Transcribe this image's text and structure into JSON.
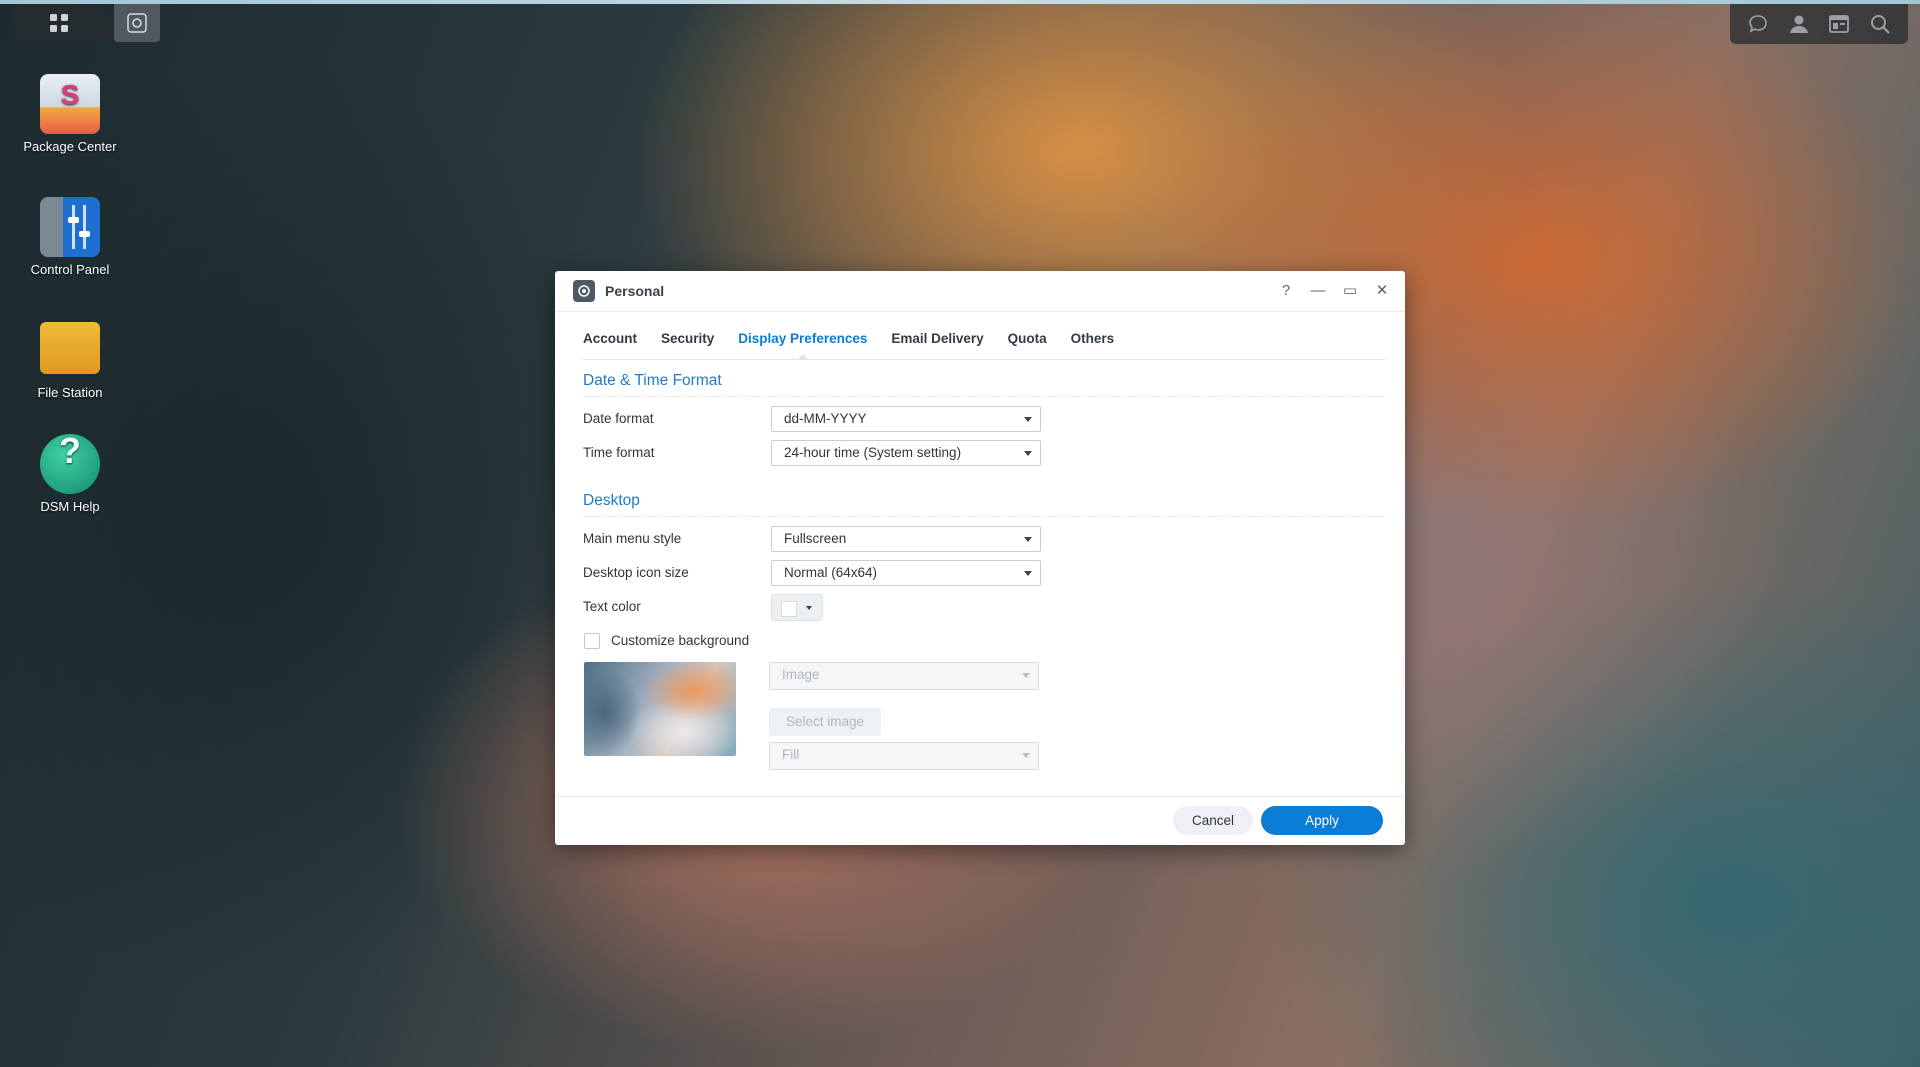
{
  "colors": {
    "accent": "#0b7dd6",
    "section_title": "#1f7bc8"
  },
  "taskbar": {
    "main_menu_icon": "grid-icon",
    "open_app_icon": "gear-icon"
  },
  "tray": {
    "icons": [
      "chat-icon",
      "user-icon",
      "widgets-icon",
      "search-icon"
    ]
  },
  "desktop": {
    "items": [
      {
        "label": "Package Center",
        "icon": "package-center-icon"
      },
      {
        "label": "Control Panel",
        "icon": "control-panel-icon"
      },
      {
        "label": "File Station",
        "icon": "folder-icon"
      },
      {
        "label": "DSM Help",
        "icon": "help-icon"
      }
    ]
  },
  "window": {
    "title": "Personal",
    "controls": {
      "help": "?",
      "minimize": "—",
      "maximize": "▭",
      "close": "✕"
    },
    "tabs": [
      "Account",
      "Security",
      "Display Preferences",
      "Email Delivery",
      "Quota",
      "Others"
    ],
    "active_tab": "Display Preferences",
    "sections": {
      "datetime": {
        "title": "Date & Time Format",
        "date_format_label": "Date format",
        "date_format_value": "dd-MM-YYYY",
        "time_format_label": "Time format",
        "time_format_value": "24-hour time (System setting)"
      },
      "desktop": {
        "title": "Desktop",
        "menu_style_label": "Main menu style",
        "menu_style_value": "Fullscreen",
        "icon_size_label": "Desktop icon size",
        "icon_size_value": "Normal (64x64)",
        "text_color_label": "Text color",
        "text_color_value": "#ffffff",
        "customize_bg_label": "Customize background",
        "customize_bg_checked": false,
        "bg_type_value": "Image",
        "select_image_label": "Select image",
        "bg_fit_value": "Fill"
      }
    },
    "footer": {
      "cancel_label": "Cancel",
      "apply_label": "Apply"
    }
  }
}
